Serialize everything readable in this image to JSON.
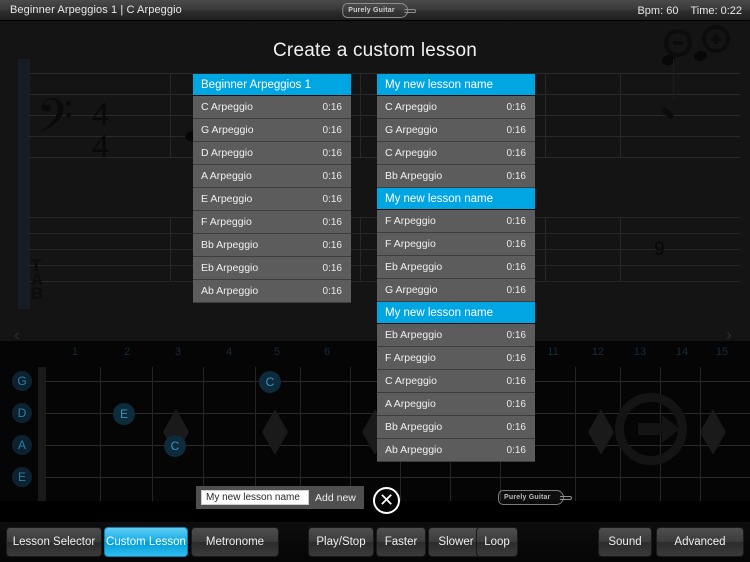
{
  "header": {
    "title": "Beginner Arpeggios 1 | C Arpeggio",
    "bpm_label": "Bpm: 60",
    "time_label": "Time: 0:22",
    "logo_text": "Purely Guitar"
  },
  "notation": {
    "clef": "bass-clef",
    "time_signature_top": "4",
    "time_signature_bottom": "4",
    "tab_letters": [
      "T",
      "A",
      "B"
    ],
    "tab_fret_number": "9",
    "prev_arrow": "‹",
    "next_arrow": "›",
    "zoom_out_label": "zoom-out",
    "zoom_in_label": "zoom-in"
  },
  "dialog": {
    "title": "Create a custom lesson",
    "left_list": {
      "header": "Beginner Arpeggios 1",
      "rows": [
        {
          "name": "C Arpeggio",
          "time": "0:16"
        },
        {
          "name": "G Arpeggio",
          "time": "0:16"
        },
        {
          "name": "D Arpeggio",
          "time": "0:16"
        },
        {
          "name": "A Arpeggio",
          "time": "0:16"
        },
        {
          "name": "E Arpeggio",
          "time": "0:16"
        },
        {
          "name": "F Arpeggio",
          "time": "0:16"
        },
        {
          "name": "Bb Arpeggio",
          "time": "0:16"
        },
        {
          "name": "Eb Arpeggio",
          "time": "0:16"
        },
        {
          "name": "Ab Arpeggio",
          "time": "0:16"
        }
      ]
    },
    "right_list": {
      "items": [
        {
          "type": "header",
          "name": "My new lesson name"
        },
        {
          "type": "row",
          "name": "C Arpeggio",
          "time": "0:16"
        },
        {
          "type": "row",
          "name": "G Arpeggio",
          "time": "0:16"
        },
        {
          "type": "row",
          "name": "C Arpeggio",
          "time": "0:16"
        },
        {
          "type": "row",
          "name": "Bb Arpeggio",
          "time": "0:16"
        },
        {
          "type": "header",
          "name": "My new lesson name"
        },
        {
          "type": "row",
          "name": "F Arpeggio",
          "time": "0:16"
        },
        {
          "type": "row",
          "name": "F Arpeggio",
          "time": "0:16"
        },
        {
          "type": "row",
          "name": "Eb Arpeggio",
          "time": "0:16"
        },
        {
          "type": "row",
          "name": "G Arpeggio",
          "time": "0:16"
        },
        {
          "type": "header",
          "name": "My new lesson name"
        },
        {
          "type": "row",
          "name": "Eb Arpeggio",
          "time": "0:16"
        },
        {
          "type": "row",
          "name": "F Arpeggio",
          "time": "0:16"
        },
        {
          "type": "row",
          "name": "C Arpeggio",
          "time": "0:16"
        },
        {
          "type": "row",
          "name": "A Arpeggio",
          "time": "0:16"
        },
        {
          "type": "row",
          "name": "Bb Arpeggio",
          "time": "0:16"
        },
        {
          "type": "row",
          "name": "Ab Arpeggio",
          "time": "0:16"
        }
      ]
    },
    "add_bar": {
      "input_value": "My new lesson name",
      "input_placeholder": "My new lesson name",
      "add_label": "Add new"
    },
    "close_label": "✕",
    "logo_text": "Purely Guitar"
  },
  "fretboard": {
    "fret_numbers": [
      "1",
      "2",
      "3",
      "4",
      "5",
      "6",
      "11",
      "12",
      "13",
      "14",
      "15"
    ],
    "open_strings": [
      "G",
      "D",
      "A",
      "E"
    ],
    "notes": [
      {
        "label": "C"
      },
      {
        "label": "E"
      },
      {
        "label": "C"
      }
    ]
  },
  "toolbar": {
    "buttons": [
      {
        "label": "Lesson Selector",
        "active": false
      },
      {
        "label": "Custom Lesson",
        "active": true
      },
      {
        "label": "Metronome",
        "active": false
      },
      {
        "label": "Play/Stop",
        "active": false
      },
      {
        "label": "Faster",
        "active": false
      },
      {
        "label": "Slower",
        "active": false
      },
      {
        "label": "Loop",
        "active": false
      },
      {
        "label": "Sound",
        "active": false
      },
      {
        "label": "Advanced",
        "active": false
      }
    ]
  },
  "colors": {
    "accent": "#00a6e2",
    "panel": "#5c5c5c",
    "background": "#141414"
  }
}
